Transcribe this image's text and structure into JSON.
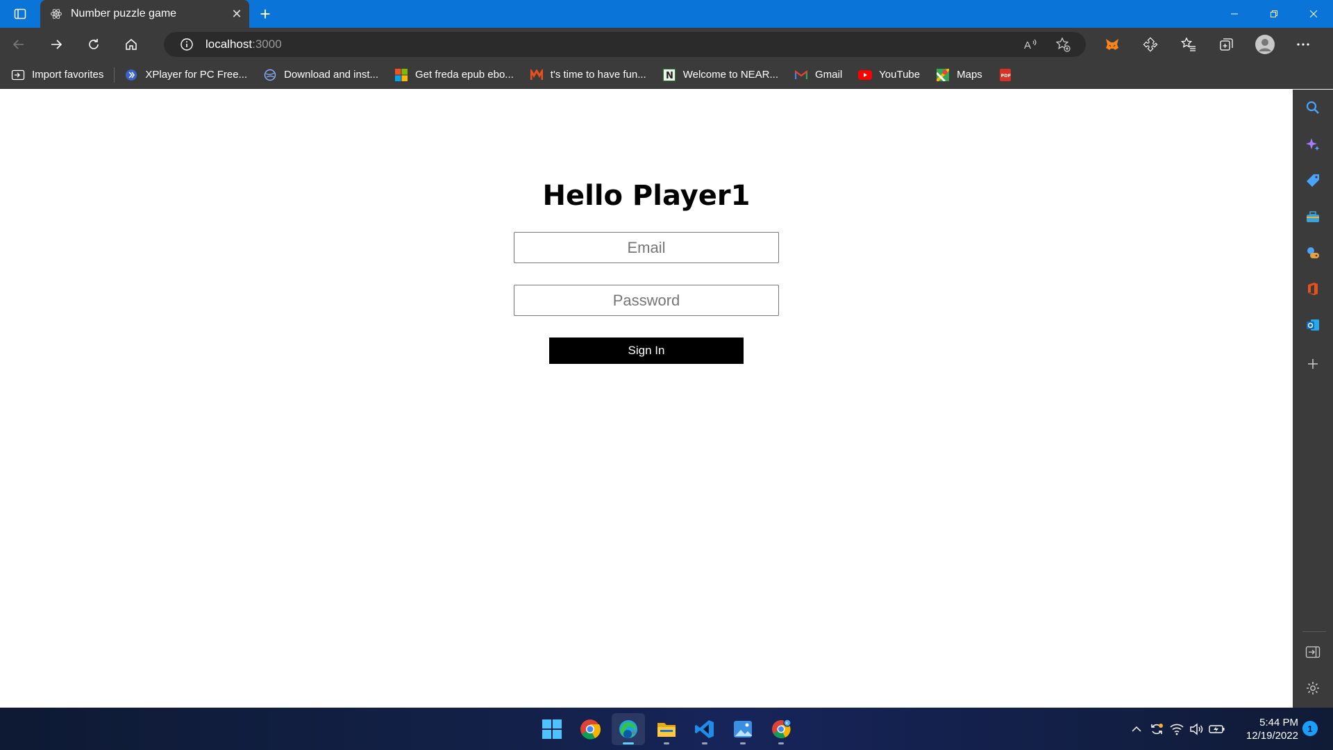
{
  "browser": {
    "tab_title": "Number puzzle game",
    "tab_close": "✕",
    "new_tab": "+",
    "url_host": "localhost",
    "url_port": ":3000"
  },
  "favorites": [
    {
      "label": "Import favorites",
      "icon": "import-favorites-icon"
    },
    {
      "label": "XPlayer for PC Free...",
      "icon": "xplayer-icon",
      "color": "#3a62c9"
    },
    {
      "label": "Download and inst...",
      "icon": "globe-icon",
      "color": "#6fa8ff"
    },
    {
      "label": "Get freda epub ebo...",
      "icon": "microsoft-icon"
    },
    {
      "label": "t's time to have fun...",
      "icon": "m-logo-icon",
      "color": "#e8501c"
    },
    {
      "label": "Welcome to NEAR...",
      "icon": "near-icon"
    },
    {
      "label": "Gmail",
      "icon": "gmail-icon"
    },
    {
      "label": "YouTube",
      "icon": "youtube-icon",
      "color": "#ff0000"
    },
    {
      "label": "Maps",
      "icon": "maps-icon"
    },
    {
      "label": "",
      "icon": "pdf-icon",
      "color": "#d93025"
    }
  ],
  "page": {
    "heading": "Hello Player1",
    "email_placeholder": "Email",
    "password_placeholder": "Password",
    "signin_label": "Sign In"
  },
  "taskbar": {
    "time": "5:44 PM",
    "date": "12/19/2022",
    "notification_count": "1"
  },
  "colors": {
    "titlebar": "#0a74d8",
    "chrome": "#3b3b3b",
    "button": "#000000"
  }
}
